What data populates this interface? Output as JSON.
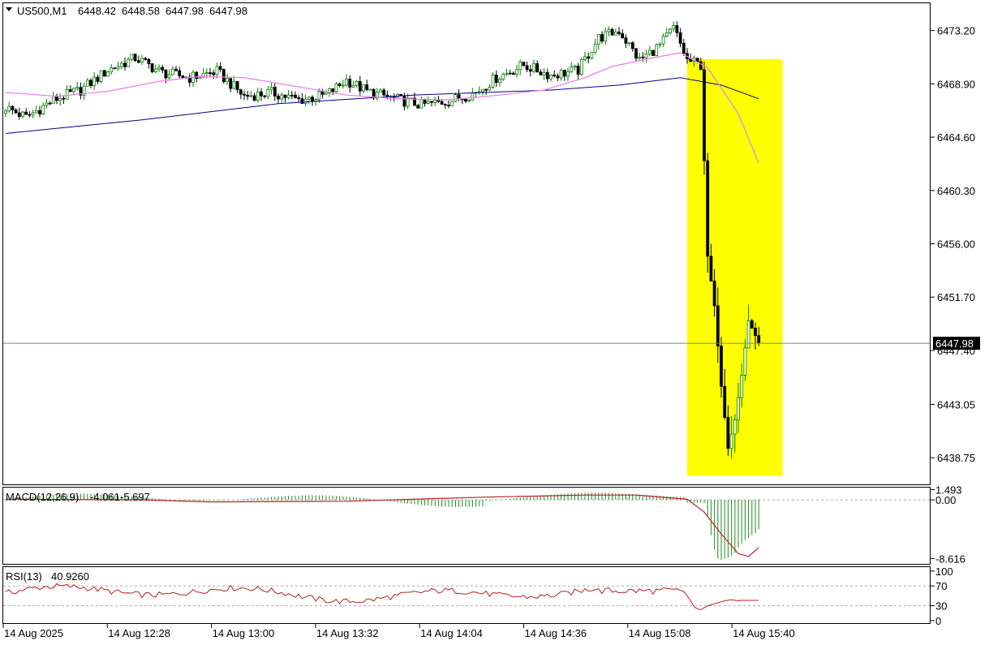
{
  "window": {
    "symbol_header": "US500,M1",
    "ohlc": [
      "6448.42",
      "6448.58",
      "6447.98",
      "6447.98"
    ]
  },
  "colors": {
    "highlight": "#ffff00",
    "ma_fast": "#ee82ee",
    "ma_slow": "#000080",
    "bull_candle": "#ffffff",
    "bear_candle": "#000000",
    "candle_up_wick": "#008000",
    "macd_hist": "#228b22",
    "macd_signal": "#b22222",
    "rsi_line": "#b22222",
    "price_line": "#778899"
  },
  "chart_data": [
    {
      "type": "candlestick",
      "title": "US500,M1",
      "price_levels": [
        "6473.20",
        "6468.90",
        "6464.60",
        "6460.30",
        "6456.00",
        "6451.70",
        "6447.40",
        "6443.05",
        "6438.75"
      ],
      "current_price": "6447.98",
      "ylim": [
        6436.6,
        6475.4
      ],
      "time_labels": [
        "14 Aug 2025",
        "14 Aug 12:28",
        "14 Aug 13:00",
        "14 Aug 13:32",
        "14 Aug 14:04",
        "14 Aug 14:36",
        "14 Aug 15:08",
        "14 Aug 15:40"
      ],
      "ma_fast_path": [
        [
          0,
          6468.2
        ],
        [
          15,
          6467.9
        ],
        [
          30,
          6468.3
        ],
        [
          45,
          6469.1
        ],
        [
          57,
          6469.5
        ],
        [
          70,
          6469.4
        ],
        [
          85,
          6468.7
        ],
        [
          100,
          6468.0
        ],
        [
          115,
          6467.7
        ],
        [
          130,
          6467.6
        ],
        [
          145,
          6468.0
        ],
        [
          158,
          6468.4
        ],
        [
          170,
          6469.4
        ],
        [
          178,
          6470.3
        ],
        [
          190,
          6471.0
        ],
        [
          198,
          6471.4
        ],
        [
          206,
          6470.2
        ],
        [
          215,
          6466.5
        ],
        [
          221,
          6462.5
        ]
      ],
      "ma_slow_path": [
        [
          0,
          6464.9
        ],
        [
          40,
          6466.0
        ],
        [
          80,
          6467.3
        ],
        [
          120,
          6468.0
        ],
        [
          160,
          6468.4
        ],
        [
          180,
          6468.8
        ],
        [
          198,
          6469.4
        ],
        [
          210,
          6468.8
        ],
        [
          221,
          6467.7
        ]
      ],
      "highlight_box": {
        "t_start": 200,
        "t_end": 228,
        "p_top": 6470.9,
        "p_bottom": 6437.3
      }
    },
    {
      "type": "histogram+line",
      "title": "MACD(12,26,9)",
      "values_text": [
        "-4.061",
        "-5.697"
      ],
      "levels": [
        "1.493",
        "0.00",
        "-8.616"
      ],
      "ylim": [
        -9.4,
        1.8
      ],
      "signal_path": [
        [
          0,
          0.1
        ],
        [
          40,
          0.0
        ],
        [
          60,
          -0.3
        ],
        [
          100,
          -0.2
        ],
        [
          140,
          0.4
        ],
        [
          170,
          0.7
        ],
        [
          185,
          0.7
        ],
        [
          195,
          0.3
        ],
        [
          200,
          0.1
        ],
        [
          205,
          -1.8
        ],
        [
          210,
          -5.0
        ],
        [
          215,
          -7.9
        ],
        [
          218,
          -8.3
        ],
        [
          221,
          -7.0
        ]
      ]
    },
    {
      "type": "line",
      "title": "RSI(13)",
      "value_text": "40.9260",
      "levels": [
        "100",
        "70",
        "30",
        "0"
      ],
      "ylim": [
        -5,
        108
      ],
      "dashed_levels": [
        70,
        30
      ]
    }
  ]
}
